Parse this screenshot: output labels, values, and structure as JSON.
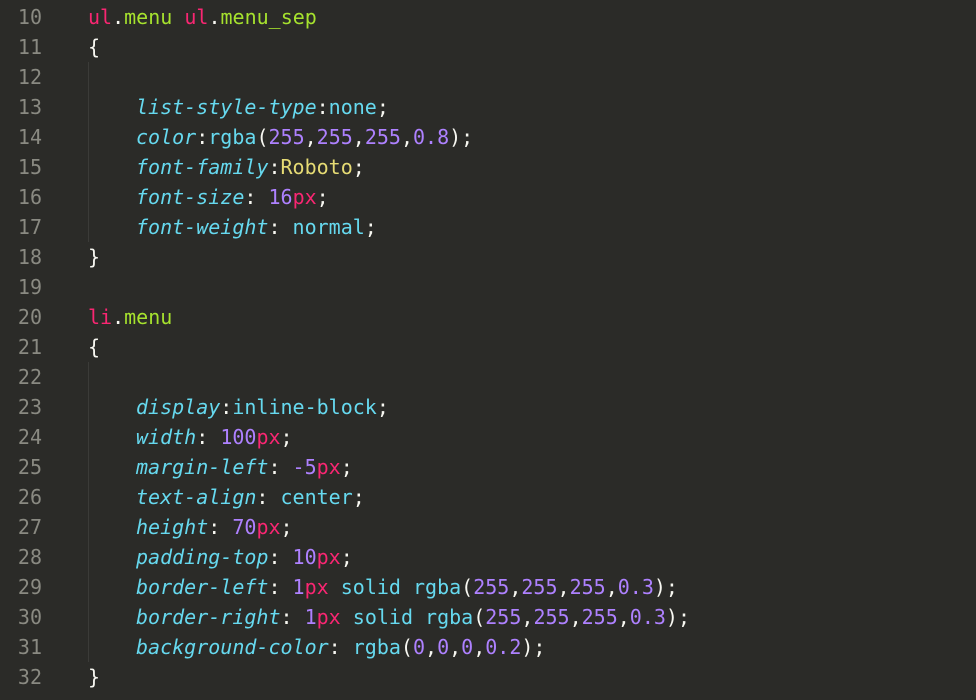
{
  "gutter": {
    "start": 10,
    "end": 32
  },
  "lines": [
    {
      "n": 10,
      "indent": 0,
      "tokens": [
        {
          "t": "ul",
          "c": "tag"
        },
        {
          "t": ".",
          "c": "punct"
        },
        {
          "t": "menu",
          "c": "class"
        },
        {
          "t": " ",
          "c": "plain"
        },
        {
          "t": "ul",
          "c": "tag"
        },
        {
          "t": ".",
          "c": "punct"
        },
        {
          "t": "menu_sep",
          "c": "class"
        }
      ]
    },
    {
      "n": 11,
      "indent": 0,
      "tokens": [
        {
          "t": "{",
          "c": "brace"
        }
      ]
    },
    {
      "n": 12,
      "indent": 1,
      "guide": true,
      "tokens": []
    },
    {
      "n": 13,
      "indent": 1,
      "guide": true,
      "tokens": [
        {
          "t": "list-style-type",
          "c": "prop"
        },
        {
          "t": ":",
          "c": "punct"
        },
        {
          "t": "none",
          "c": "value"
        },
        {
          "t": ";",
          "c": "punct"
        }
      ]
    },
    {
      "n": 14,
      "indent": 1,
      "guide": true,
      "tokens": [
        {
          "t": "color",
          "c": "prop"
        },
        {
          "t": ":",
          "c": "punct"
        },
        {
          "t": "rgba",
          "c": "func"
        },
        {
          "t": "(",
          "c": "plain"
        },
        {
          "t": "255",
          "c": "num"
        },
        {
          "t": ",",
          "c": "plain"
        },
        {
          "t": "255",
          "c": "num"
        },
        {
          "t": ",",
          "c": "plain"
        },
        {
          "t": "255",
          "c": "num"
        },
        {
          "t": ",",
          "c": "plain"
        },
        {
          "t": "0.8",
          "c": "num"
        },
        {
          "t": ")",
          "c": "plain"
        },
        {
          "t": ";",
          "c": "punct"
        }
      ]
    },
    {
      "n": 15,
      "indent": 1,
      "guide": true,
      "tokens": [
        {
          "t": "font-family",
          "c": "prop"
        },
        {
          "t": ":",
          "c": "punct"
        },
        {
          "t": "Roboto",
          "c": "ident"
        },
        {
          "t": ";",
          "c": "punct"
        }
      ]
    },
    {
      "n": 16,
      "indent": 1,
      "guide": true,
      "tokens": [
        {
          "t": "font-size",
          "c": "prop"
        },
        {
          "t": ": ",
          "c": "punct"
        },
        {
          "t": "16",
          "c": "num"
        },
        {
          "t": "px",
          "c": "unit"
        },
        {
          "t": ";",
          "c": "punct"
        }
      ]
    },
    {
      "n": 17,
      "indent": 1,
      "guide": true,
      "tokens": [
        {
          "t": "font-weight",
          "c": "prop"
        },
        {
          "t": ": ",
          "c": "punct"
        },
        {
          "t": "normal",
          "c": "value"
        },
        {
          "t": ";",
          "c": "punct"
        }
      ]
    },
    {
      "n": 18,
      "indent": 0,
      "tokens": [
        {
          "t": "}",
          "c": "brace"
        }
      ]
    },
    {
      "n": 19,
      "indent": 0,
      "tokens": []
    },
    {
      "n": 20,
      "indent": 0,
      "tokens": [
        {
          "t": "li",
          "c": "tag"
        },
        {
          "t": ".",
          "c": "punct"
        },
        {
          "t": "menu",
          "c": "class"
        }
      ]
    },
    {
      "n": 21,
      "indent": 0,
      "tokens": [
        {
          "t": "{",
          "c": "brace"
        }
      ]
    },
    {
      "n": 22,
      "indent": 1,
      "guide": true,
      "tokens": []
    },
    {
      "n": 23,
      "indent": 1,
      "guide": true,
      "tokens": [
        {
          "t": "display",
          "c": "prop"
        },
        {
          "t": ":",
          "c": "punct"
        },
        {
          "t": "inline-block",
          "c": "value"
        },
        {
          "t": ";",
          "c": "punct"
        }
      ]
    },
    {
      "n": 24,
      "indent": 1,
      "guide": true,
      "tokens": [
        {
          "t": "width",
          "c": "prop"
        },
        {
          "t": ": ",
          "c": "punct"
        },
        {
          "t": "100",
          "c": "num"
        },
        {
          "t": "px",
          "c": "unit"
        },
        {
          "t": ";",
          "c": "punct"
        }
      ]
    },
    {
      "n": 25,
      "indent": 1,
      "guide": true,
      "tokens": [
        {
          "t": "margin-left",
          "c": "prop"
        },
        {
          "t": ": ",
          "c": "punct"
        },
        {
          "t": "-5",
          "c": "num"
        },
        {
          "t": "px",
          "c": "unit"
        },
        {
          "t": ";",
          "c": "punct"
        }
      ]
    },
    {
      "n": 26,
      "indent": 1,
      "guide": true,
      "tokens": [
        {
          "t": "text-align",
          "c": "prop"
        },
        {
          "t": ": ",
          "c": "punct"
        },
        {
          "t": "center",
          "c": "value"
        },
        {
          "t": ";",
          "c": "punct"
        }
      ]
    },
    {
      "n": 27,
      "indent": 1,
      "guide": true,
      "tokens": [
        {
          "t": "height",
          "c": "prop"
        },
        {
          "t": ": ",
          "c": "punct"
        },
        {
          "t": "70",
          "c": "num"
        },
        {
          "t": "px",
          "c": "unit"
        },
        {
          "t": ";",
          "c": "punct"
        }
      ]
    },
    {
      "n": 28,
      "indent": 1,
      "guide": true,
      "tokens": [
        {
          "t": "padding-top",
          "c": "prop"
        },
        {
          "t": ": ",
          "c": "punct"
        },
        {
          "t": "10",
          "c": "num"
        },
        {
          "t": "px",
          "c": "unit"
        },
        {
          "t": ";",
          "c": "punct"
        }
      ]
    },
    {
      "n": 29,
      "indent": 1,
      "guide": true,
      "tokens": [
        {
          "t": "border-left",
          "c": "prop"
        },
        {
          "t": ": ",
          "c": "punct"
        },
        {
          "t": "1",
          "c": "num"
        },
        {
          "t": "px",
          "c": "unit"
        },
        {
          "t": " ",
          "c": "plain"
        },
        {
          "t": "solid",
          "c": "value"
        },
        {
          "t": " ",
          "c": "plain"
        },
        {
          "t": "rgba",
          "c": "func"
        },
        {
          "t": "(",
          "c": "plain"
        },
        {
          "t": "255",
          "c": "num"
        },
        {
          "t": ",",
          "c": "plain"
        },
        {
          "t": "255",
          "c": "num"
        },
        {
          "t": ",",
          "c": "plain"
        },
        {
          "t": "255",
          "c": "num"
        },
        {
          "t": ",",
          "c": "plain"
        },
        {
          "t": "0.3",
          "c": "num"
        },
        {
          "t": ")",
          "c": "plain"
        },
        {
          "t": ";",
          "c": "punct"
        }
      ]
    },
    {
      "n": 30,
      "indent": 1,
      "guide": true,
      "tokens": [
        {
          "t": "border-right",
          "c": "prop"
        },
        {
          "t": ": ",
          "c": "punct"
        },
        {
          "t": "1",
          "c": "num"
        },
        {
          "t": "px",
          "c": "unit"
        },
        {
          "t": " ",
          "c": "plain"
        },
        {
          "t": "solid",
          "c": "value"
        },
        {
          "t": " ",
          "c": "plain"
        },
        {
          "t": "rgba",
          "c": "func"
        },
        {
          "t": "(",
          "c": "plain"
        },
        {
          "t": "255",
          "c": "num"
        },
        {
          "t": ",",
          "c": "plain"
        },
        {
          "t": "255",
          "c": "num"
        },
        {
          "t": ",",
          "c": "plain"
        },
        {
          "t": "255",
          "c": "num"
        },
        {
          "t": ",",
          "c": "plain"
        },
        {
          "t": "0.3",
          "c": "num"
        },
        {
          "t": ")",
          "c": "plain"
        },
        {
          "t": ";",
          "c": "punct"
        }
      ]
    },
    {
      "n": 31,
      "indent": 1,
      "guide": true,
      "tokens": [
        {
          "t": "background-color",
          "c": "prop"
        },
        {
          "t": ": ",
          "c": "punct"
        },
        {
          "t": "rgba",
          "c": "func"
        },
        {
          "t": "(",
          "c": "plain"
        },
        {
          "t": "0",
          "c": "num"
        },
        {
          "t": ",",
          "c": "plain"
        },
        {
          "t": "0",
          "c": "num"
        },
        {
          "t": ",",
          "c": "plain"
        },
        {
          "t": "0",
          "c": "num"
        },
        {
          "t": ",",
          "c": "plain"
        },
        {
          "t": "0.2",
          "c": "num"
        },
        {
          "t": ")",
          "c": "plain"
        },
        {
          "t": ";",
          "c": "punct"
        }
      ]
    },
    {
      "n": 32,
      "indent": 0,
      "tokens": [
        {
          "t": "}",
          "c": "brace"
        }
      ]
    }
  ]
}
